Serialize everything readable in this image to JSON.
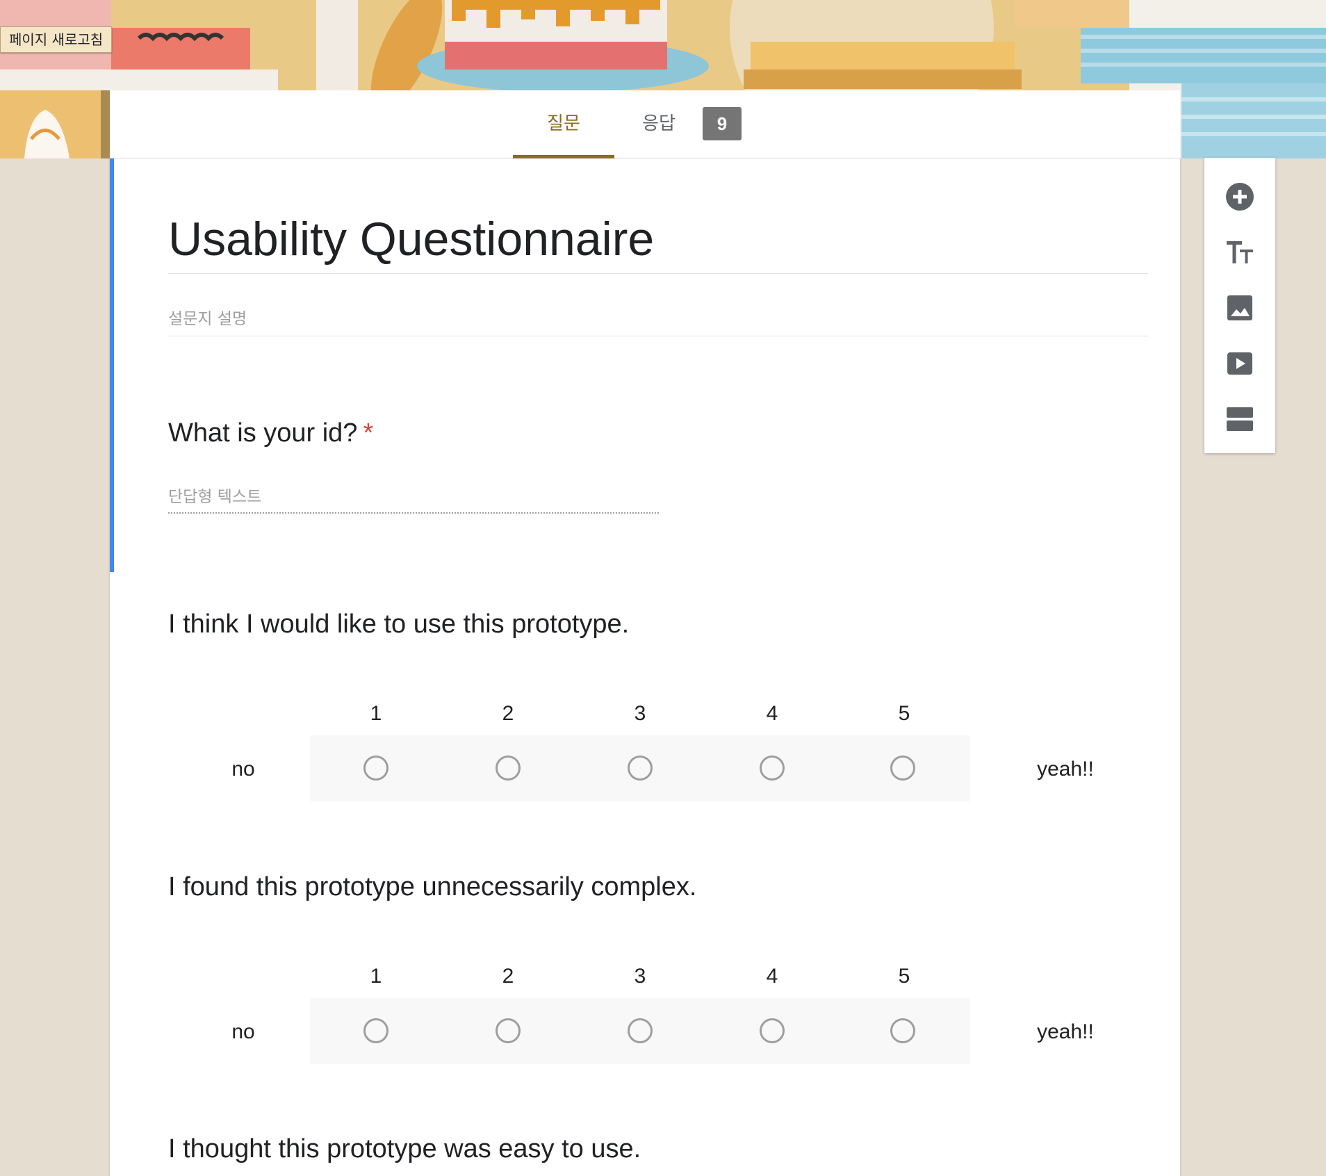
{
  "toolbar": {
    "refresh_label": "페이지 새로고침"
  },
  "tabs": {
    "questions": "질문",
    "responses": "응답",
    "response_count": "9"
  },
  "form": {
    "title": "Usability Questionnaire",
    "description_placeholder": "설문지 설명"
  },
  "questions": [
    {
      "title": "What is your id?",
      "required_mark": "*",
      "answer_placeholder": "단답형 텍스트"
    },
    {
      "title": "I think I would like to use this prototype.",
      "scale": [
        "1",
        "2",
        "3",
        "4",
        "5"
      ],
      "low_label": "no",
      "high_label": "yeah!!"
    },
    {
      "title": "I found this prototype unnecessarily complex.",
      "scale": [
        "1",
        "2",
        "3",
        "4",
        "5"
      ],
      "low_label": "no",
      "high_label": "yeah!!"
    },
    {
      "title": "I thought this prototype was easy to use."
    }
  ],
  "side_tools": [
    "add-question-icon",
    "title-text-icon",
    "image-icon",
    "video-icon",
    "section-icon"
  ],
  "colors": {
    "accent": "#8a6d1e",
    "focus": "#4285f4",
    "required": "#db4437",
    "background": "#e4ddd0"
  }
}
